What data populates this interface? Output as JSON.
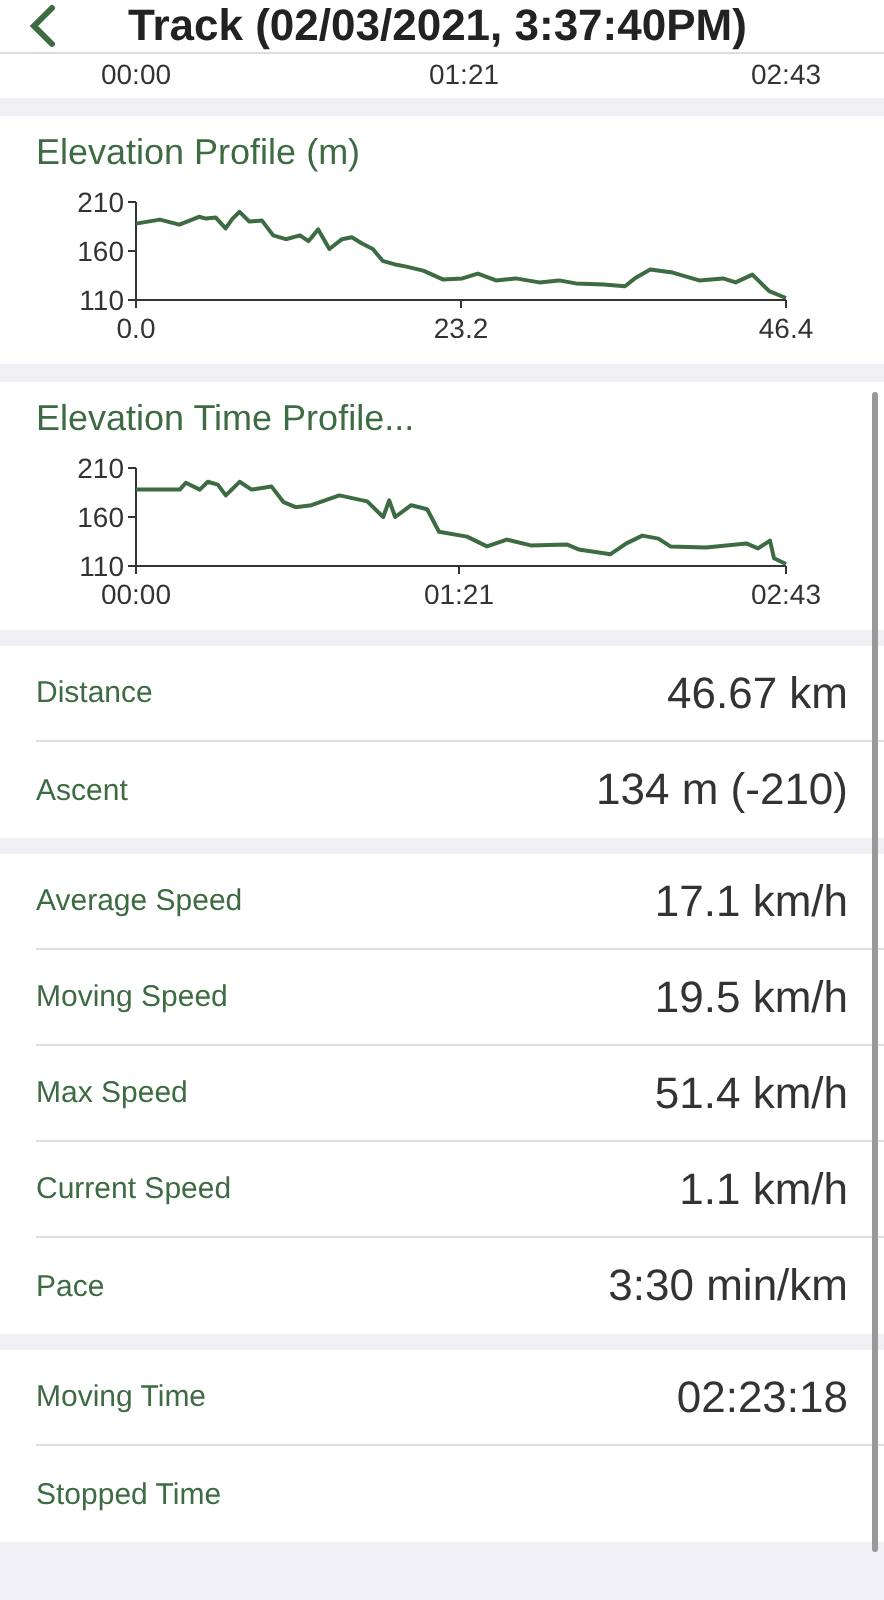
{
  "header": {
    "title": "Track (02/03/2021, 3:37:40PM)"
  },
  "partial_chart": {
    "xticks": [
      "00:00",
      "01:21",
      "02:43"
    ]
  },
  "charts": [
    {
      "title": "Elevation Profile (m)",
      "chart_data": {
        "type": "line",
        "x": [
          0,
          1.7,
          3.1,
          4.5,
          5.0,
          5.7,
          6.4,
          6.9,
          7.4,
          8.1,
          9.0,
          9.8,
          10.7,
          11.7,
          12.3,
          13.0,
          13.8,
          14.7,
          15.4,
          16.1,
          16.9,
          17.6,
          18.6,
          19.3,
          20.5,
          21.9,
          23.3,
          24.4,
          25.7,
          27.1,
          28.8,
          30.2,
          31.4,
          33.4,
          34.9,
          35.7,
          36.7,
          38.3,
          40.2,
          41.9,
          42.8,
          44.0,
          45.2,
          46.4
        ],
        "series": [
          {
            "color": "#3d6b42",
            "values": [
              188,
              192,
              187,
              195,
              193,
              194,
              183,
              193,
              200,
              190,
              191,
              176,
              172,
              176,
              170,
              182,
              162,
              172,
              174,
              168,
              162,
              150,
              146,
              144,
              140,
              131,
              132,
              137,
              130,
              132,
              128,
              130,
              127,
              126,
              124,
              133,
              141,
              138,
              130,
              132,
              128,
              136,
              119,
              112
            ]
          }
        ],
        "xlim": [
          0,
          46.4
        ],
        "ylim": [
          110,
          210
        ],
        "xticks": [
          {
            "value": 0,
            "label": "0.0"
          },
          {
            "value": 23.2,
            "label": "23.2"
          },
          {
            "value": 46.4,
            "label": "46.4"
          }
        ],
        "yticks": [
          110,
          160,
          210
        ]
      }
    },
    {
      "title": "Elevation Time Profile...",
      "chart_data": {
        "type": "line",
        "x": [
          0,
          11,
          12.5,
          16,
          18,
          20.5,
          22.5,
          26,
          29,
          34,
          37,
          40,
          44,
          51,
          58,
          62,
          63.5,
          65,
          69,
          73,
          76,
          83,
          88,
          93,
          99,
          108,
          111,
          119,
          123,
          127,
          131,
          134,
          143,
          153,
          156,
          159,
          160,
          163
        ],
        "series": [
          {
            "color": "#3d6b42",
            "values": [
              188,
              188,
              195,
              188,
              196,
              193,
              182,
              196,
              188,
              191,
              175,
              170,
              172,
              182,
              176,
              160,
              177,
              160,
              172,
              168,
              145,
              140,
              130,
              137,
              131,
              132,
              127,
              122,
              133,
              141,
              138,
              130,
              129,
              133,
              128,
              136,
              118,
              112
            ]
          }
        ],
        "xlim": [
          0,
          163
        ],
        "ylim": [
          110,
          210
        ],
        "xticks": [
          {
            "value": 0,
            "label": "00:00"
          },
          {
            "value": 81,
            "label": "01:21"
          },
          {
            "value": 163,
            "label": "02:43"
          }
        ],
        "yticks": [
          110,
          160,
          210
        ]
      }
    }
  ],
  "stat_groups": [
    [
      {
        "label": "Distance",
        "value": "46.67 km"
      },
      {
        "label": "Ascent",
        "value": "134 m (-210)"
      }
    ],
    [
      {
        "label": "Average Speed",
        "value": "17.1 km/h"
      },
      {
        "label": "Moving Speed",
        "value": "19.5 km/h"
      },
      {
        "label": "Max Speed",
        "value": "51.4 km/h"
      },
      {
        "label": "Current Speed",
        "value": "1.1 km/h"
      },
      {
        "label": "Pace",
        "value": "3:30 min/km"
      }
    ],
    [
      {
        "label": "Moving Time",
        "value": "02:23:18"
      },
      {
        "label": "Stopped Time"
      }
    ]
  ]
}
